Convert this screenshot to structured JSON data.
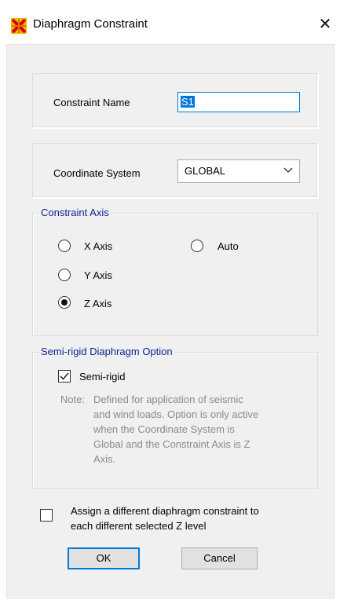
{
  "window": {
    "title": "Diaphragm Constraint"
  },
  "constraint_name": {
    "label": "Constraint Name",
    "value": "S1"
  },
  "coordinate_system": {
    "label": "Coordinate System",
    "selected": "GLOBAL"
  },
  "constraint_axis": {
    "legend": "Constraint Axis",
    "options": [
      "X Axis",
      "Y Axis",
      "Z Axis",
      "Auto"
    ],
    "selected": "Z Axis"
  },
  "semi_rigid": {
    "legend": "Semi-rigid Diaphragm Option",
    "checkbox_label": "Semi-rigid",
    "checked": true,
    "note_prefix": "Note:",
    "note_lines": [
      "Defined for application of seismic",
      "and wind loads. Option is only active",
      "when the Coordinate System is",
      "Global and the Constraint Axis is Z",
      "Axis."
    ]
  },
  "assign_option": {
    "label_lines": [
      "Assign a different diaphragm constraint to",
      "each different selected Z level"
    ],
    "checked": false
  },
  "buttons": {
    "ok": "OK",
    "cancel": "Cancel"
  },
  "colors": {
    "accent": "#0078d7",
    "legend": "#0b1f8f",
    "app_icon": "#e8a200"
  }
}
